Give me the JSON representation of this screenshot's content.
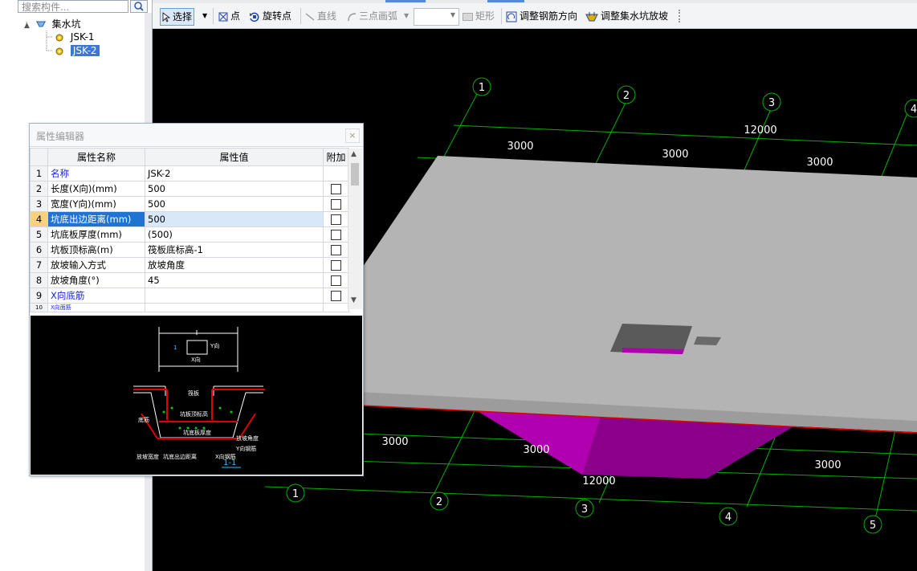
{
  "tree": {
    "search_placeholder": "搜索构件...",
    "root_label": "集水坑",
    "items": [
      {
        "label": "JSK-1",
        "selected": false
      },
      {
        "label": "JSK-2",
        "selected": true
      }
    ]
  },
  "toolbar": {
    "select": "选择",
    "point": "点",
    "rotate_point": "旋转点",
    "line": "直线",
    "three_point_arc": "三点画弧",
    "rectangle": "矩形",
    "adjust_rebar_dir": "调整钢筋方向",
    "adjust_pit_slope": "调整集水坑放坡"
  },
  "prop_editor": {
    "title": "属性编辑器",
    "close": "×",
    "headers": {
      "name": "属性名称",
      "value": "属性值",
      "extra": "附加"
    },
    "rows": [
      {
        "num": "1",
        "name": "名称",
        "value": "JSK-2",
        "blue": true,
        "checkbox": false
      },
      {
        "num": "2",
        "name": "长度(X向)(mm)",
        "value": "500",
        "blue": false,
        "checkbox": true
      },
      {
        "num": "3",
        "name": "宽度(Y向)(mm)",
        "value": "500",
        "blue": false,
        "checkbox": true
      },
      {
        "num": "4",
        "name": "坑底出边距离(mm)",
        "value": "500",
        "blue": false,
        "checkbox": true,
        "current": true
      },
      {
        "num": "5",
        "name": "坑底板厚度(mm)",
        "value": "(500)",
        "blue": false,
        "checkbox": true
      },
      {
        "num": "6",
        "name": "坑板顶标高(m)",
        "value": "筏板底标高-1",
        "blue": false,
        "checkbox": true
      },
      {
        "num": "7",
        "name": "放坡输入方式",
        "value": "放坡角度",
        "blue": false,
        "checkbox": true
      },
      {
        "num": "8",
        "name": "放坡角度(°)",
        "value": "45",
        "blue": false,
        "checkbox": true
      },
      {
        "num": "9",
        "name": "X向底筋",
        "value": "",
        "blue": true,
        "checkbox": true
      },
      {
        "num": "10",
        "name": "X向面筋",
        "value": "",
        "blue": true,
        "checkbox": false
      }
    ],
    "preview": {
      "label_1": "1",
      "label_x": "X向",
      "label_y": "Y向",
      "labels": [
        "坑板顶标高",
        "坑底板厚度",
        "放坡角度",
        "Y向钢筋",
        "X向钢筋",
        "放坡宽度",
        "坑底出边距离",
        "筏板",
        "底筋"
      ],
      "section": "1-1"
    }
  },
  "viewport": {
    "axis_top": [
      "1",
      "2",
      "3",
      "4"
    ],
    "axis_bottom": [
      "1",
      "2",
      "3",
      "4",
      "5"
    ],
    "dims_top": [
      "12000",
      "3000",
      "3000",
      "3000"
    ],
    "dims_bottom": [
      "3000",
      "3000",
      "12000",
      "3000"
    ],
    "colors": {
      "slab": "#b4b4b4",
      "pit": "#9a009a",
      "grid": "#00b000",
      "background": "#000000"
    }
  }
}
